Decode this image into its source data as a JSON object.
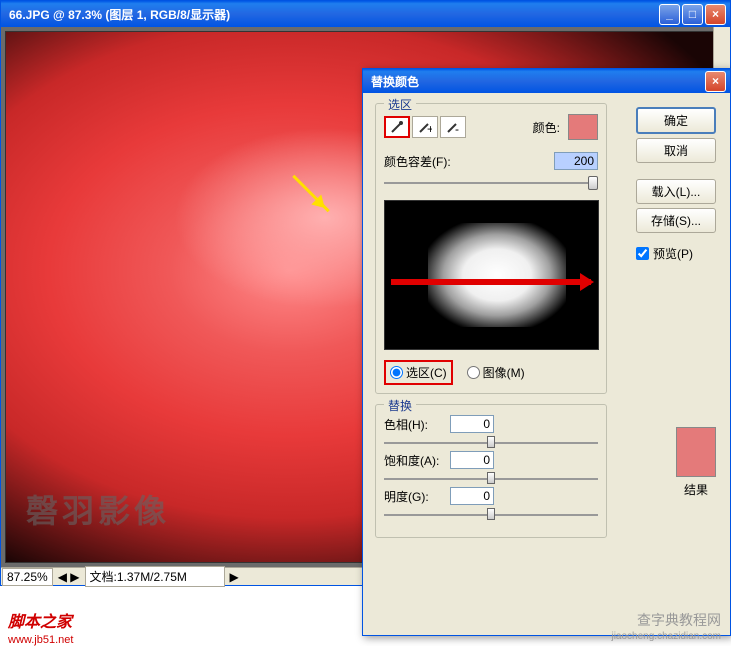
{
  "main": {
    "title": "66.JPG @ 87.3% (图层 1, RGB/8/显示器)",
    "zoom": "87.25%",
    "doc_size": "文档:1.37M/2.75M",
    "watermark": "磬羽影像"
  },
  "dialog": {
    "title": "替换颜色",
    "section_selection": "选区",
    "color_label": "颜色:",
    "swatch_color": "#e47a7a",
    "tolerance_label": "颜色容差(F):",
    "tolerance_value": "200",
    "radio_selection": "选区(C)",
    "radio_image": "图像(M)",
    "section_replace": "替换",
    "hue_label": "色相(H):",
    "hue_value": "0",
    "sat_label": "饱和度(A):",
    "sat_value": "0",
    "light_label": "明度(G):",
    "light_value": "0",
    "result_label": "结果",
    "buttons": {
      "ok": "确定",
      "cancel": "取消",
      "load": "载入(L)...",
      "save": "存储(S)...",
      "preview": "预览(P)"
    }
  },
  "footer": {
    "brand": "脚本之家",
    "url": "www.jb51.net",
    "wm1": "查字典教程网",
    "wm2": "jiaocheng.chazidian.com"
  }
}
